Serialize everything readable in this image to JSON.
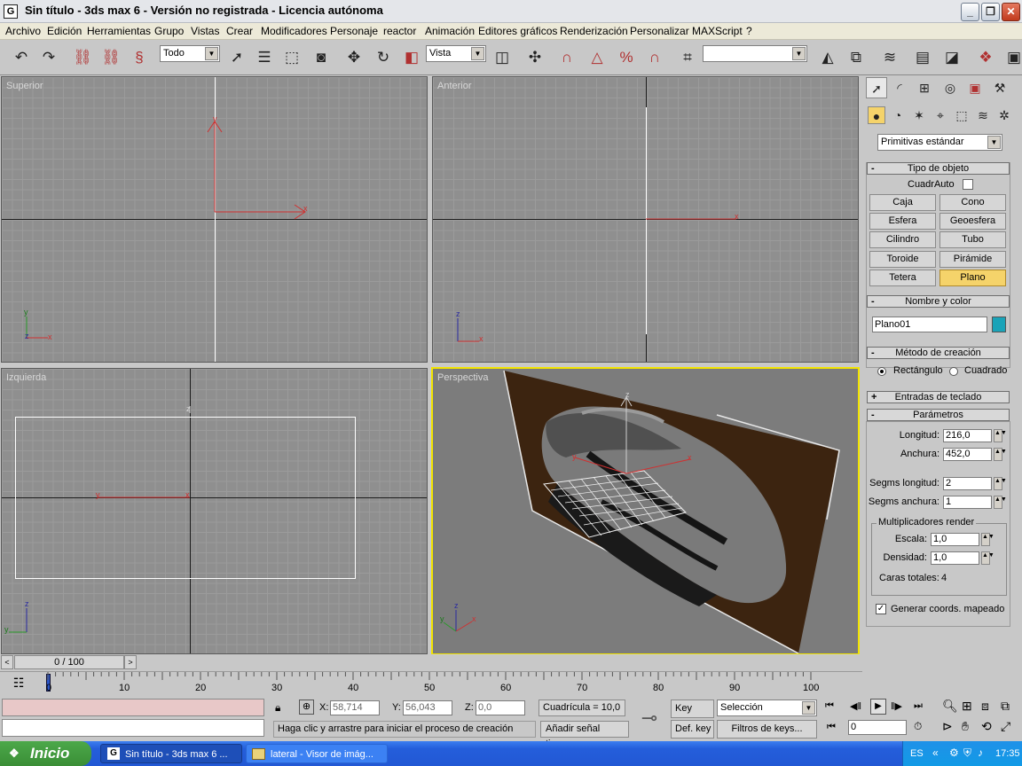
{
  "window": {
    "title": "Sin título - 3ds max 6 - Versión no registrada - Licencia autónoma",
    "icon_letter": "G"
  },
  "menu": [
    "Archivo",
    "Edición",
    "Herramientas",
    "Grupo",
    "Vistas",
    "Crear",
    "Modificadores",
    "Personaje",
    "reactor",
    "Animación",
    "Editores gráficos",
    "Renderización",
    "Personalizar",
    "MAXScript",
    "?"
  ],
  "toolbar": {
    "selection_filter": "Todo",
    "reference_coord": "Vista",
    "named_selection": ""
  },
  "viewports": {
    "top": "Superior",
    "front": "Anterior",
    "left": "Izquierda",
    "perspective": "Perspectiva"
  },
  "command_panel": {
    "category": "Primitivas estándar",
    "object_type": {
      "header": "Tipo de objeto",
      "autogrid": "CuadrAuto",
      "buttons": [
        "Caja",
        "Cono",
        "Esfera",
        "Geoesfera",
        "Cilindro",
        "Tubo",
        "Toroide",
        "Pirámide",
        "Tetera",
        "Plano"
      ],
      "active": "Plano"
    },
    "name_color": {
      "header": "Nombre y color",
      "name": "Plano01",
      "color": "#1aa3b8"
    },
    "creation_method": {
      "header": "Método de creación",
      "options": [
        "Rectángulo",
        "Cuadrado"
      ],
      "selected": "Rectángulo"
    },
    "keyboard_entry": {
      "header": "Entradas de teclado"
    },
    "parameters": {
      "header": "Parámetros",
      "length_label": "Longitud:",
      "length": "216,0",
      "width_label": "Anchura:",
      "width": "452,0",
      "length_segs_label": "Segms longitud:",
      "length_segs": "2",
      "width_segs_label": "Segms anchura:",
      "width_segs": "1",
      "render_mult": "Multiplicadores render",
      "scale_label": "Escala:",
      "scale": "1,0",
      "density_label": "Densidad:",
      "density": "1,0",
      "total_faces_label": "Caras totales:",
      "total_faces": "4",
      "gen_mapping": "Generar coords. mapeado",
      "gen_mapping_checked": true
    }
  },
  "time_slider": {
    "label": "0 / 100",
    "ticks": [
      "0",
      "10",
      "20",
      "30",
      "40",
      "50",
      "60",
      "70",
      "80",
      "90",
      "100"
    ]
  },
  "status": {
    "x_label": "X:",
    "x": "58,714",
    "y_label": "Y:",
    "y": "56,043",
    "z_label": "Z:",
    "z": "0,0",
    "grid": "Cuadrícula = 10,0",
    "prompt": "Haga clic y arrastre para iniciar el proceso de creación",
    "add_time_tag": "Añadir señal tiempo",
    "auto_key": "Key auto",
    "set_key": "Def. key",
    "key_mode": "Selección",
    "key_filters": "Filtros de keys...",
    "frame": "0"
  },
  "taskbar": {
    "start": "Inicio",
    "tasks": [
      "Sin título - 3ds max 6 ...",
      "lateral - Visor de imág..."
    ],
    "lang": "ES",
    "clock": "17:35"
  }
}
